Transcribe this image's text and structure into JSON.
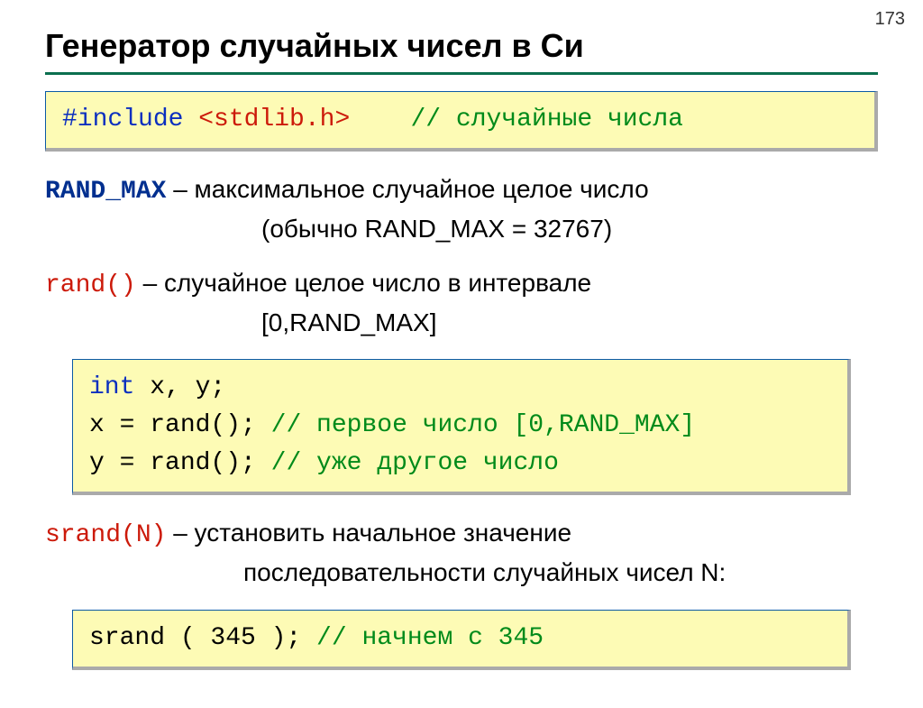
{
  "page_number": "173",
  "title": "Генератор случайных чисел в Си",
  "box1": {
    "include_kw": "#include ",
    "include_hdr": "<stdlib.h>",
    "spacer": "    ",
    "comment": "// случайные числа"
  },
  "randmax": {
    "term": "RAND_MAX",
    "desc_line1": " – максимальное случайное целое число",
    "desc_line2": "(обычно RAND_MAX = 32767)"
  },
  "rand": {
    "term": "rand()",
    "spacer": "  ",
    "desc_line1": " – случайное целое число в интервале",
    "desc_line2": "[0,RAND_MAX]"
  },
  "box2": {
    "line1_a": "int",
    "line1_b": " x, y;",
    "line2_a": "x = rand(); ",
    "line2_b": "// первое число [0,RAND_MAX]",
    "line3_a": "y = rand(); ",
    "line3_b": "// уже другое число"
  },
  "srand": {
    "term": "srand(N)",
    "desc_line1": " – установить начальное значение",
    "desc_line2": "последовательности случайных чисел N:"
  },
  "box3": {
    "code": "srand ( 345 ); ",
    "comment": "// начнем с 345"
  }
}
